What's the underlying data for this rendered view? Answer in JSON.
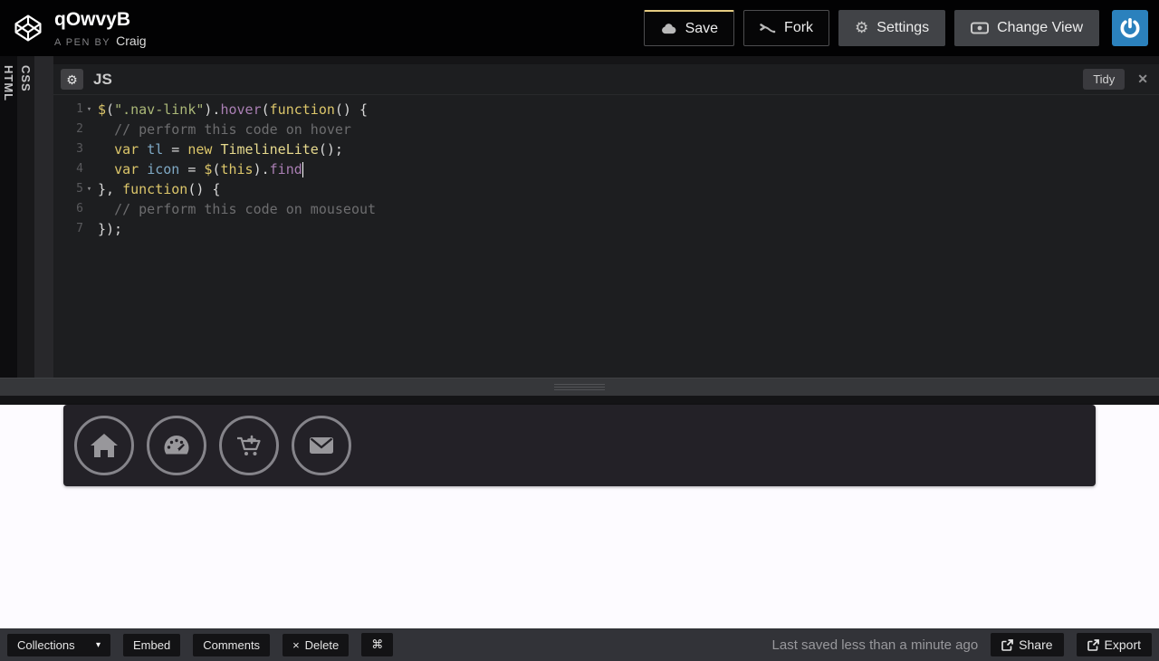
{
  "header": {
    "pen_title": "qOwvyB",
    "byline_prefix": "A PEN BY",
    "author": "Craig",
    "save_label": "Save",
    "fork_label": "Fork",
    "settings_label": "Settings",
    "change_view_label": "Change View"
  },
  "panels": {
    "html_label": "HTML",
    "css_label": "CSS",
    "js_label": "JS",
    "tidy_label": "Tidy"
  },
  "icons": {
    "gear": "⚙",
    "close": "✕",
    "caret": "▾",
    "fold": "▾",
    "command": "⌘",
    "delete_x": "×",
    "logo": "codepen-cube",
    "save": "cloud-icon",
    "fork": "fork-icon",
    "change_view": "eye-panel-icon",
    "power": "power-icon",
    "share_export": "external-link-icon",
    "preview_nav": [
      "home-icon",
      "dashboard-icon",
      "cart-plus-icon",
      "envelope-icon"
    ]
  },
  "editor": {
    "code_lines": [
      {
        "num": "1",
        "fold": true,
        "cursor": false,
        "tokens": [
          [
            "kw",
            "$"
          ],
          [
            "plain",
            "("
          ],
          [
            "str",
            "\".nav-link\""
          ],
          [
            "plain",
            ")."
          ],
          [
            "fn",
            "hover"
          ],
          [
            "plain",
            "("
          ],
          [
            "kw",
            "function"
          ],
          [
            "plain",
            "() {"
          ]
        ]
      },
      {
        "num": "2",
        "fold": false,
        "cursor": false,
        "tokens": [
          [
            "plain",
            "  "
          ],
          [
            "cmt",
            "// perform this code on hover"
          ]
        ]
      },
      {
        "num": "3",
        "fold": false,
        "cursor": false,
        "tokens": [
          [
            "plain",
            "  "
          ],
          [
            "kw",
            "var"
          ],
          [
            "plain",
            " "
          ],
          [
            "var",
            "tl"
          ],
          [
            "plain",
            " = "
          ],
          [
            "kw",
            "new"
          ],
          [
            "plain",
            " "
          ],
          [
            "type",
            "TimelineLite"
          ],
          [
            "plain",
            "();"
          ]
        ]
      },
      {
        "num": "4",
        "fold": false,
        "cursor": true,
        "tokens": [
          [
            "plain",
            "  "
          ],
          [
            "kw",
            "var"
          ],
          [
            "plain",
            " "
          ],
          [
            "var",
            "icon"
          ],
          [
            "plain",
            " = "
          ],
          [
            "kw",
            "$"
          ],
          [
            "plain",
            "("
          ],
          [
            "kw",
            "this"
          ],
          [
            "plain",
            ")."
          ],
          [
            "fn",
            "find"
          ]
        ]
      },
      {
        "num": "5",
        "fold": true,
        "cursor": false,
        "tokens": [
          [
            "plain",
            "}, "
          ],
          [
            "kw",
            "function"
          ],
          [
            "plain",
            "() {"
          ]
        ]
      },
      {
        "num": "6",
        "fold": false,
        "cursor": false,
        "tokens": [
          [
            "plain",
            "  "
          ],
          [
            "cmt",
            "// perform this code on mouseout"
          ]
        ]
      },
      {
        "num": "7",
        "fold": false,
        "cursor": false,
        "tokens": [
          [
            "plain",
            "});"
          ]
        ]
      }
    ]
  },
  "footer": {
    "collections_label": "Collections",
    "embed_label": "Embed",
    "comments_label": "Comments",
    "delete_label": "Delete",
    "last_saved": "Last saved less than a minute ago",
    "share_label": "Share",
    "export_label": "Export"
  },
  "colors": {
    "header_bg": "#020203",
    "save_accent": "#e5cc82",
    "gray_button": "#414347",
    "power_blue": "#2b81bd",
    "editor_bg": "#1d1e20",
    "preview_bg": "#fdfbff",
    "result_nav_bg": "#232127",
    "footer_bg": "#323338",
    "code_keyword": "#dcc66a",
    "code_variable": "#7fa9c5",
    "code_string": "#abb878",
    "code_function": "#aa7fb4",
    "code_comment": "#6d6d6f"
  }
}
